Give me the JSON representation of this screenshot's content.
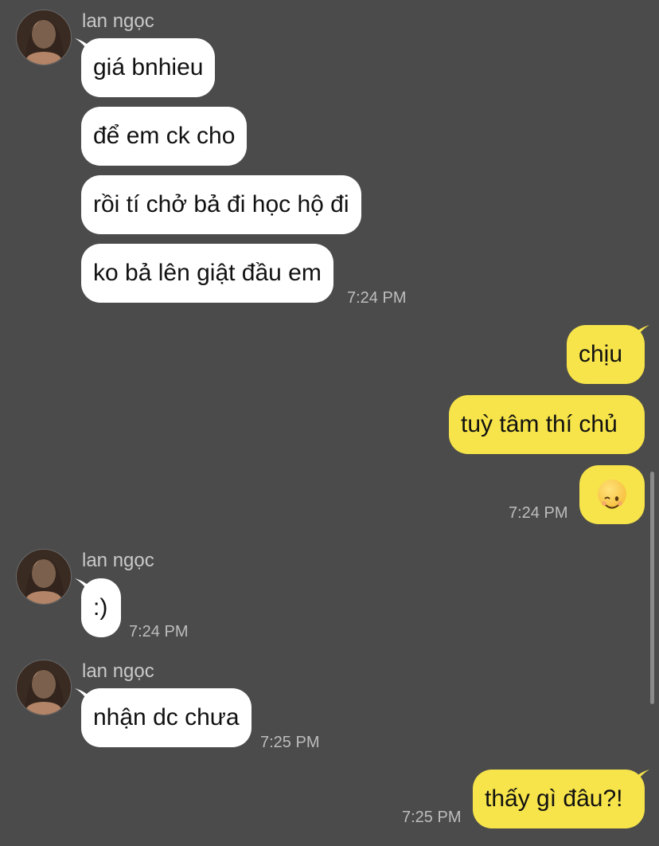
{
  "colors": {
    "background": "#4b4b4b",
    "incoming_bubble": "#ffffff",
    "outgoing_bubble": "#f7e44a",
    "sender_name": "#c9c9c9",
    "timestamp": "#bdbdbd"
  },
  "groups": [
    {
      "sender": "lan ngọc",
      "messages": [
        "giá bnhieu",
        "để em ck cho",
        "rồi tí chở bả đi học hộ đi",
        "ko bả lên giật đầu em"
      ],
      "time": "7:24 PM"
    },
    {
      "outgoing": true,
      "messages": [
        "chịu",
        "tuỳ tâm thí chủ"
      ],
      "emoji": "winking-face-emoji",
      "time": "7:24 PM"
    },
    {
      "sender": "lan ngọc",
      "messages": [
        ":)"
      ],
      "time": "7:24 PM"
    },
    {
      "sender": "lan ngọc",
      "messages": [
        "nhận dc chưa"
      ],
      "time": "7:25 PM"
    },
    {
      "outgoing": true,
      "messages": [
        "thấy gì đâu?!"
      ],
      "time": "7:25 PM"
    }
  ]
}
